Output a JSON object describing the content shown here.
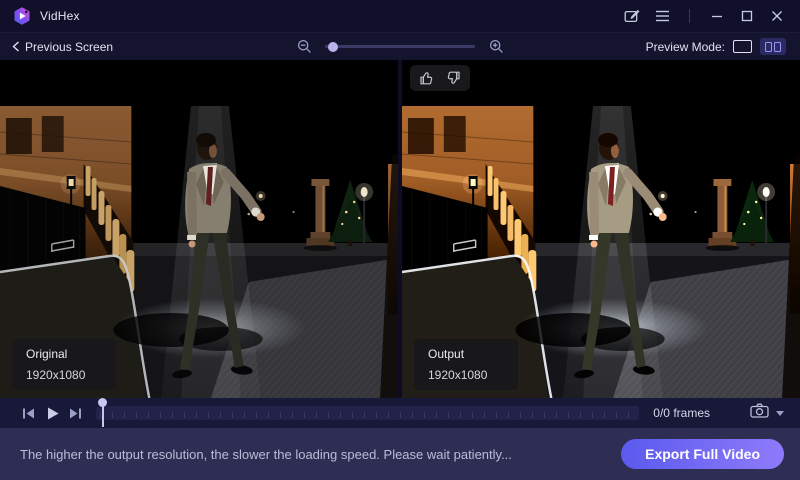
{
  "window": {
    "title": "VidHex"
  },
  "titlebar": {
    "icons": [
      "feedback-edit-icon",
      "menu-icon",
      "minimize-icon",
      "maximize-icon",
      "close-icon"
    ]
  },
  "toolbar": {
    "back_label": "Previous Screen",
    "zoom": {
      "icons": [
        "zoom-out-icon",
        "zoom-in-icon"
      ],
      "thumb_position_percent": 3
    },
    "preview_mode_label": "Preview Mode:",
    "preview_modes": [
      "single-view",
      "split-view"
    ],
    "active_preview_mode": "split-view"
  },
  "panels": [
    {
      "label": "Original",
      "resolution": "1920x1080"
    },
    {
      "label": "Output",
      "resolution": "1920x1080"
    }
  ],
  "feedback": {
    "icons": [
      "thumbs-up-icon",
      "thumbs-down-icon"
    ]
  },
  "playback": {
    "icons": [
      "previous-frame-icon",
      "play-icon",
      "next-frame-icon",
      "screenshot-camera-icon",
      "dropdown-caret-icon"
    ],
    "frames_label": "0/0 frames",
    "progress_percent": 0
  },
  "statusbar": {
    "message": "The higher the output resolution, the slower the loading speed. Please wait patiently...",
    "export_button_label": "Export Full Video"
  },
  "scene": {
    "description": "Night street scene: man in tweed suit and striped tie dancing in a vertical spotlight beam on a cobbled street; orange-lit building with colonnade and iron fence on the left, stone column, Christmas tree and street lamp on the right"
  },
  "colors": {
    "titlebar_bg": "#10102a",
    "toolbar_bg": "#14142f",
    "playbar_bg": "#181838",
    "statusbar_bg": "#2e2e55",
    "accent": "#6c63f0",
    "export_gradient": [
      "#5a5aee",
      "#8e7bfa"
    ]
  }
}
